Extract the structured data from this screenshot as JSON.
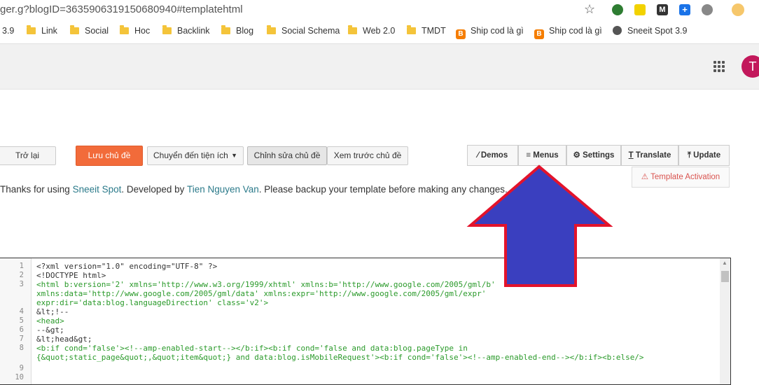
{
  "browser": {
    "url": "ger.g?blogID=3635906319150680940#templatehtml",
    "bookmarks": [
      {
        "label": "3.9",
        "icon": "none"
      },
      {
        "label": "Link",
        "icon": "folder"
      },
      {
        "label": "Social",
        "icon": "folder"
      },
      {
        "label": "Hoc",
        "icon": "folder"
      },
      {
        "label": "Backlink",
        "icon": "folder"
      },
      {
        "label": "Blog",
        "icon": "folder"
      },
      {
        "label": "Social Schema",
        "icon": "folder"
      },
      {
        "label": "Web 2.0",
        "icon": "folder"
      },
      {
        "label": "TMDT",
        "icon": "folder"
      },
      {
        "label": "Ship cod là gì",
        "icon": "blogger"
      },
      {
        "label": "Ship cod là gì",
        "icon": "blogger"
      },
      {
        "label": "Sneeit Spot 3.9",
        "icon": "globe"
      }
    ]
  },
  "header": {
    "avatar_letter": "T"
  },
  "toolbar": {
    "back": "Trở lại",
    "save": "Lưu chủ đề",
    "jump": "Chuyển đến tiện ích",
    "edit": "Chỉnh sửa chủ đề",
    "preview": "Xem trước chủ đề"
  },
  "sneeit": {
    "demos": "Demos",
    "menus": "Menus",
    "settings": "Settings",
    "translate": "Translate",
    "update": "Update",
    "activation": "Template Activation"
  },
  "notice": {
    "prefix": "Thanks for using ",
    "link1": "Sneeit Spot",
    "middle": ". Developed by ",
    "link2": "Tien Nguyen Van",
    "suffix": ". Please backup your template before making any changes."
  },
  "editor": {
    "line_numbers": [
      "1",
      "2",
      "3",
      "",
      "",
      "4",
      "5",
      "6",
      "7",
      "8",
      "",
      "9",
      "10"
    ],
    "lines": [
      "<?xml version=\"1.0\" encoding=\"UTF-8\" ?>",
      "<!DOCTYPE html>",
      "<html b:version='2' xmlns='http://www.w3.org/1999/xhtml' xmlns:b='http://www.google.com/2005/gml/b'",
      "xmlns:data='http://www.google.com/2005/gml/data' xmlns:expr='http://www.google.com/2005/gml/expr'",
      "expr:dir='data:blog.languageDirection' class='v2'>",
      "&lt;!--",
      "<head>",
      "--&gt;",
      "&lt;head&gt;",
      "<b:if cond='false'><!--amp-enabled-start--></b:if><b:if cond='false and data:blog.pageType in",
      "{&quot;static_page&quot;,&quot;item&quot;} and data:blog.isMobileRequest'><b:if cond='false'><!--amp-enabled-end--></b:if><b:else/>",
      "",
      ""
    ]
  },
  "colors": {
    "arrow_fill": "#3a3fbf",
    "arrow_stroke": "#e3132b",
    "save_button": "#f26b3a"
  }
}
